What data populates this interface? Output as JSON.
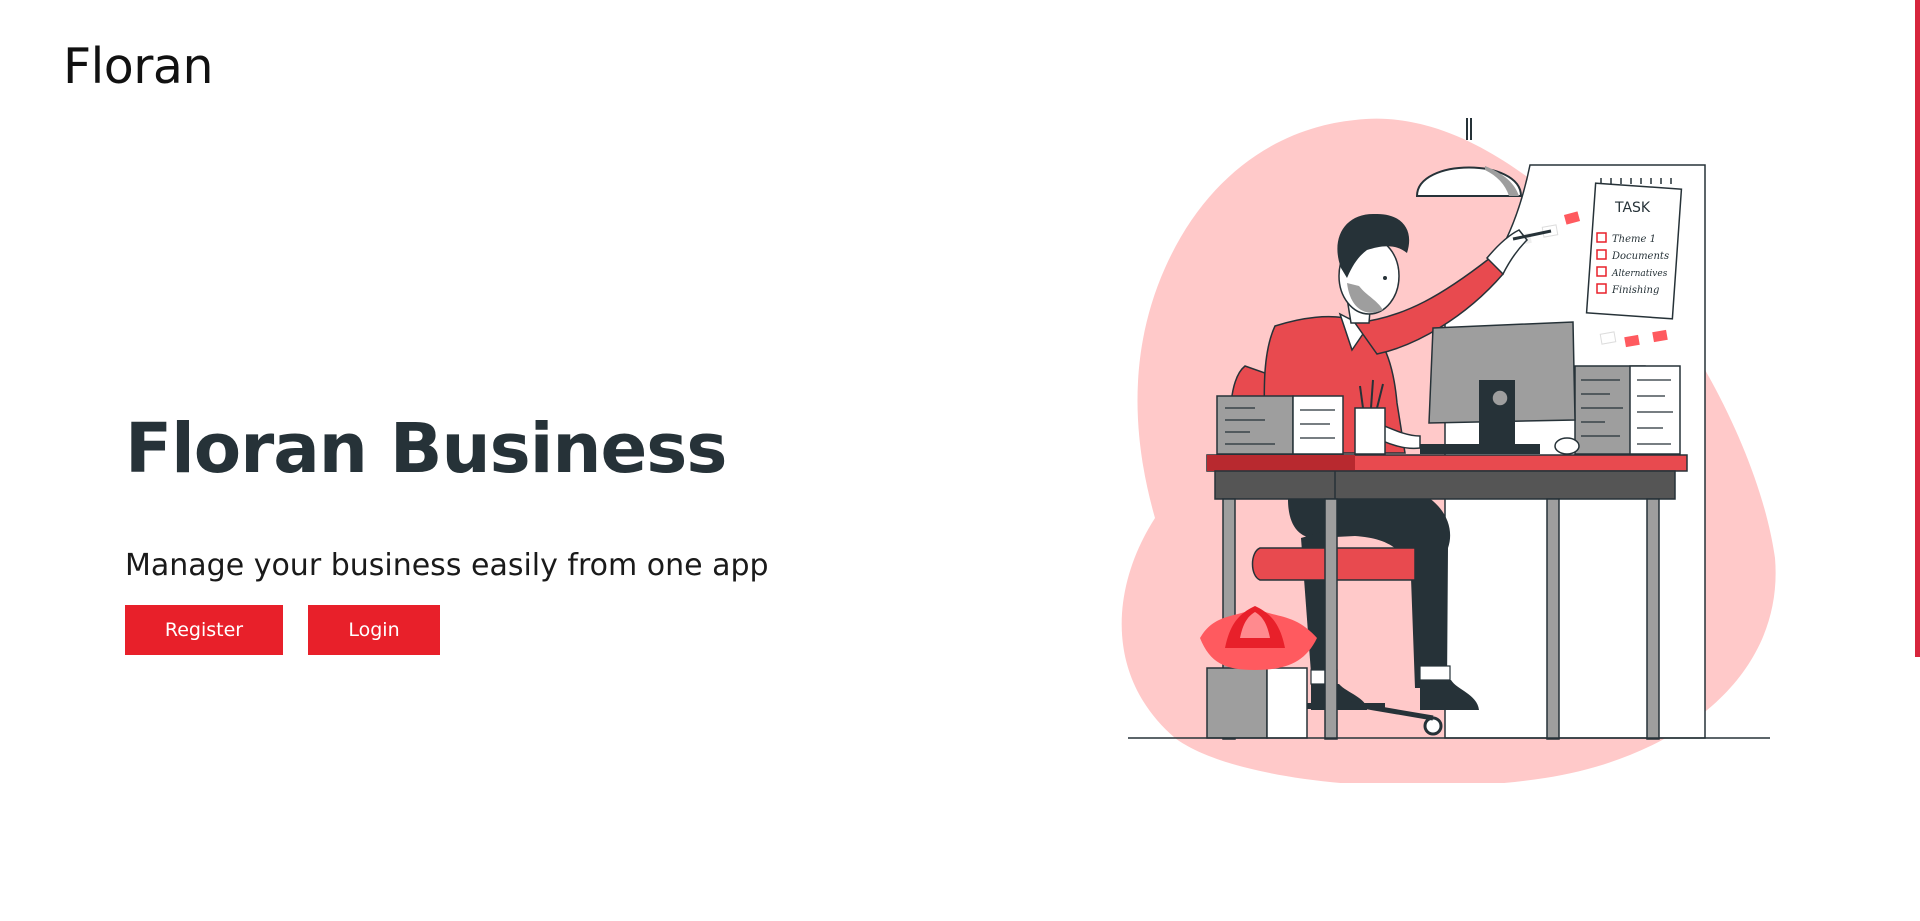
{
  "header": {
    "logo": "Floran"
  },
  "hero": {
    "title": "Floran Business",
    "subtitle": "Manage your business easily from one app",
    "register_label": "Register",
    "login_label": "Login"
  },
  "illustration": {
    "task_title": "TASK",
    "task_items": [
      "Theme 1",
      "Documents",
      "Alternatives",
      "Finishing"
    ]
  },
  "colors": {
    "accent": "#e8202a",
    "blob": "#ffc9c9",
    "dark": "#263238"
  }
}
